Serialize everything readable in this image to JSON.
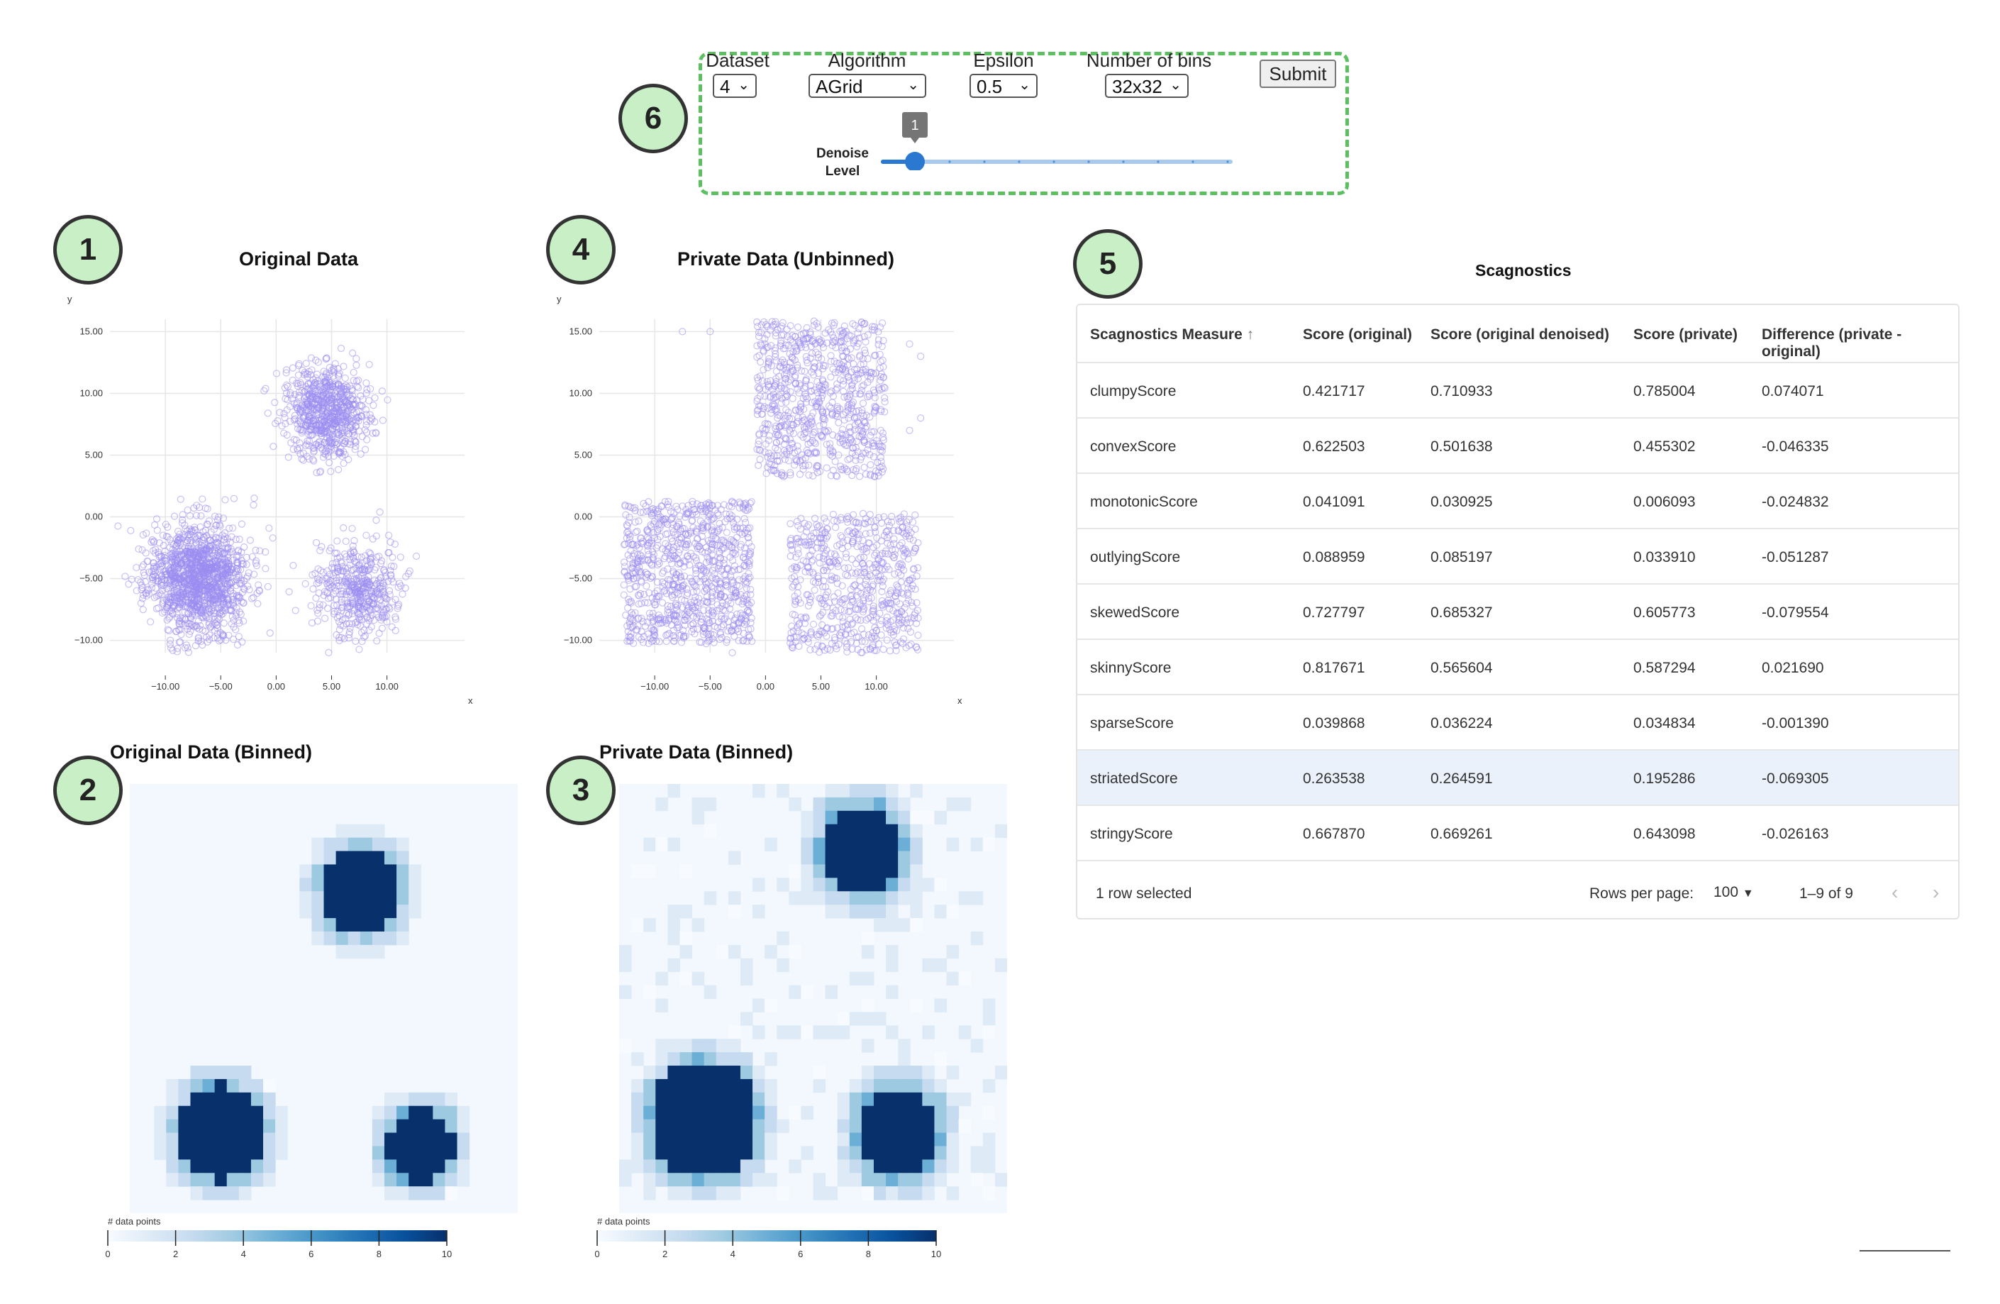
{
  "controls": {
    "dataset_label": "Dataset",
    "dataset_value": "4",
    "algorithm_label": "Algorithm",
    "algorithm_value": "AGrid",
    "epsilon_label": "Epsilon",
    "epsilon_value": "0.5",
    "bins_label": "Number of bins",
    "bins_value": "32x32",
    "submit_label": "Submit",
    "denoise_label_1": "Denoise",
    "denoise_label_2": "Level",
    "denoise_value": "1",
    "denoise_min": 1,
    "denoise_max": 10
  },
  "badges": [
    "1",
    "2",
    "3",
    "4",
    "5",
    "6"
  ],
  "panels": {
    "original_title": "Original Data",
    "private_title": "Private Data (Unbinned)",
    "original_binned_title": "Original Data (Binned)",
    "private_binned_title": "Private Data (Binned)",
    "scagnostics_title": "Scagnostics"
  },
  "chart_data": [
    {
      "type": "scatter",
      "title": "Original Data",
      "xlabel": "x",
      "ylabel": "y",
      "xlim": [
        -15,
        17
      ],
      "ylim": [
        -11,
        16
      ],
      "x_ticks": [
        "−10.00",
        "−5.00",
        "0.00",
        "5.00",
        "10.00"
      ],
      "y_ticks": [
        "15.00",
        "10.00",
        "5.00",
        "0.00",
        "−5.00",
        "−10.00"
      ],
      "clusters": [
        {
          "center": [
            -7,
            -5
          ],
          "spread": 3
        },
        {
          "center": [
            4.5,
            8.5
          ],
          "spread": 2.5
        },
        {
          "center": [
            7.5,
            -6
          ],
          "spread": 2.5
        }
      ],
      "color": "#9b8cf0"
    },
    {
      "type": "scatter",
      "title": "Private Data (Unbinned)",
      "xlabel": "x",
      "ylabel": "y",
      "xlim": [
        -15,
        17
      ],
      "ylim": [
        -11,
        16
      ],
      "x_ticks": [
        "−10.00",
        "−5.00",
        "0.00",
        "5.00",
        "10.00"
      ],
      "y_ticks": [
        "15.00",
        "10.00",
        "5.00",
        "0.00",
        "−5.00",
        "−10.00"
      ],
      "clusters": [
        {
          "center": [
            -7,
            -4.5
          ],
          "spread": 3.5
        },
        {
          "center": [
            5,
            9.5
          ],
          "spread": 3.5
        },
        {
          "center": [
            8,
            -5.5
          ],
          "spread": 3.5
        }
      ],
      "color": "#9b8cf0"
    },
    {
      "type": "heatmap",
      "title": "Original Data (Binned)",
      "legend_title": "# data points",
      "legend_ticks": [
        "0",
        "2",
        "4",
        "6",
        "8",
        "10"
      ],
      "range": [
        0,
        10
      ],
      "grid": 32
    },
    {
      "type": "heatmap",
      "title": "Private Data (Binned)",
      "legend_title": "# data points",
      "legend_ticks": [
        "0",
        "2",
        "4",
        "6",
        "8",
        "10"
      ],
      "range": [
        0,
        10
      ],
      "grid": 32
    }
  ],
  "table": {
    "columns": [
      "Scagnostics Measure",
      "Score (original)",
      "Score (original denoised)",
      "Score (private)",
      "Difference (private - original)"
    ],
    "sort_icon": "arrow-up-icon",
    "rows": [
      [
        "clumpyScore",
        "0.421717",
        "0.710933",
        "0.785004",
        "0.074071"
      ],
      [
        "convexScore",
        "0.622503",
        "0.501638",
        "0.455302",
        "-0.046335"
      ],
      [
        "monotonicScore",
        "0.041091",
        "0.030925",
        "0.006093",
        "-0.024832"
      ],
      [
        "outlyingScore",
        "0.088959",
        "0.085197",
        "0.033910",
        "-0.051287"
      ],
      [
        "skewedScore",
        "0.727797",
        "0.685327",
        "0.605773",
        "-0.079554"
      ],
      [
        "skinnyScore",
        "0.817671",
        "0.565604",
        "0.587294",
        "0.021690"
      ],
      [
        "sparseScore",
        "0.039868",
        "0.036224",
        "0.034834",
        "-0.001390"
      ],
      [
        "striatedScore",
        "0.263538",
        "0.264591",
        "0.195286",
        "-0.069305"
      ],
      [
        "stringyScore",
        "0.667870",
        "0.669261",
        "0.643098",
        "-0.026163"
      ]
    ],
    "selected_row": 7,
    "footer_selected": "1 row selected",
    "rows_per_page_label": "Rows per page:",
    "rows_per_page_value": "100",
    "pagination": "1–9 of 9",
    "colors": {
      "selected": "#ebf1fb"
    }
  }
}
